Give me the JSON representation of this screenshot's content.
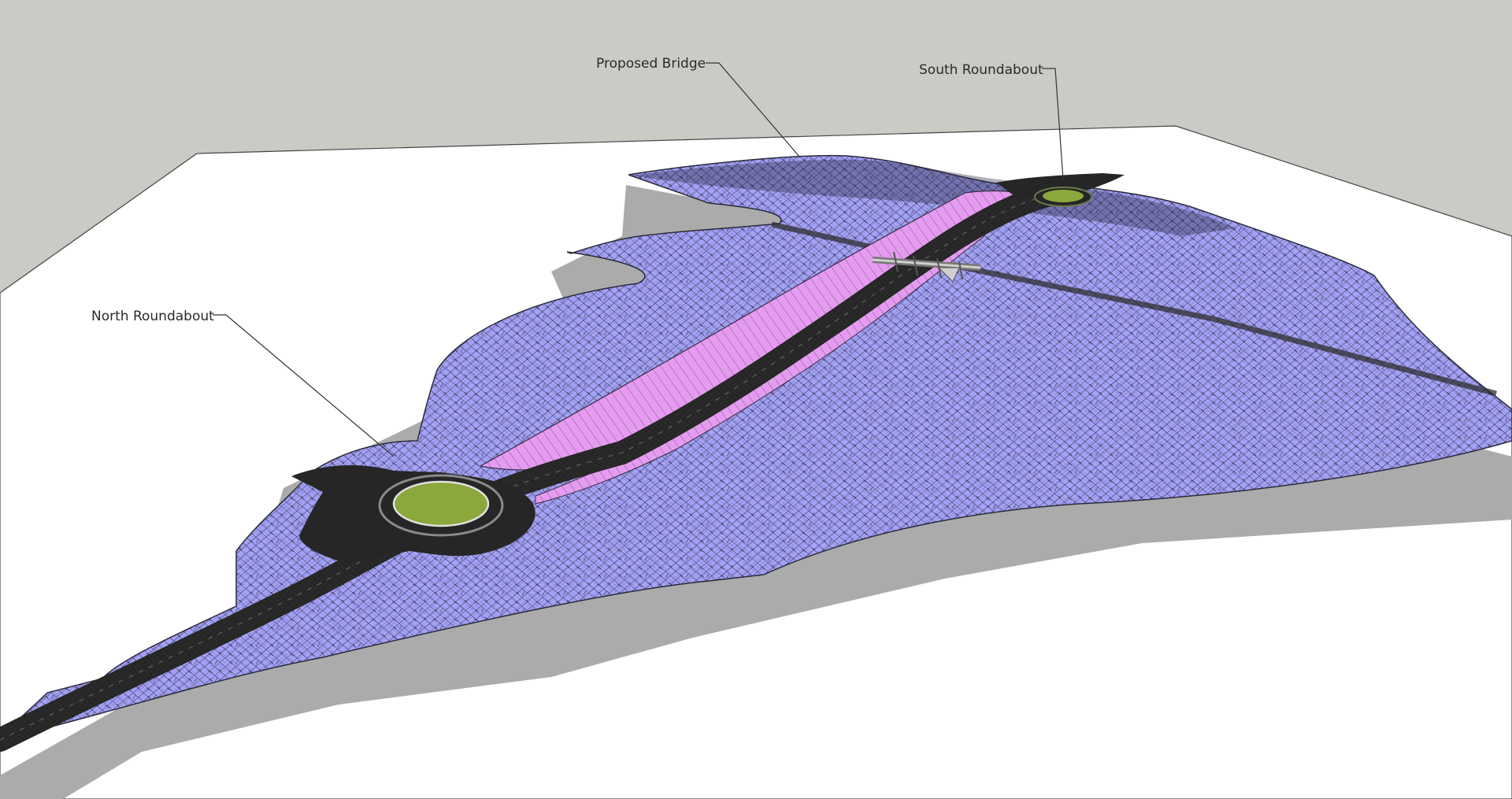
{
  "scene": {
    "colors": {
      "sky": "#cbcbc6",
      "ground": "#ffffff",
      "shadow": "#ababab",
      "terrain": "#a5a3f8",
      "embankment": "#e59cf0",
      "road": "#262626",
      "roundabout_center": "#8aa83c"
    }
  },
  "callouts": {
    "proposed_bridge": "Proposed Bridge",
    "south_roundabout": "South Roundabout",
    "north_roundabout": "North Roundabout"
  }
}
